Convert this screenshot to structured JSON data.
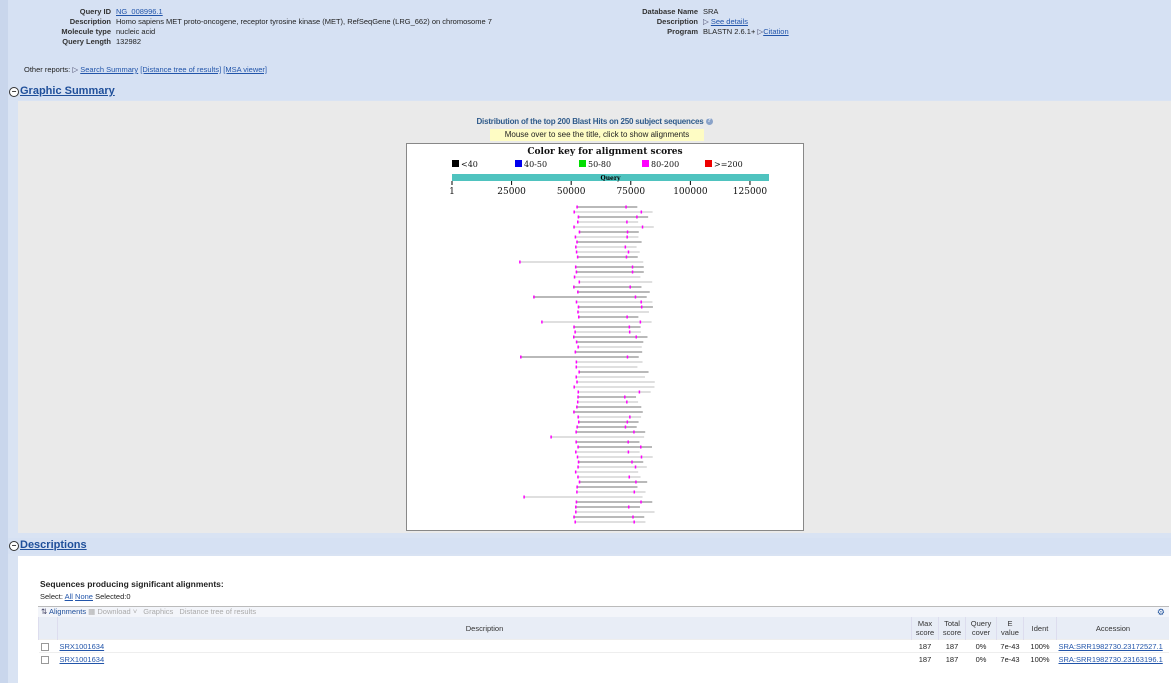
{
  "query_info": {
    "query_id_label": "Query ID",
    "query_id": "NG_008996.1",
    "description_label": "Description",
    "description": "Homo sapiens MET proto-oncogene, receptor tyrosine kinase (MET), RefSeqGene (LRG_662) on chromosome 7",
    "molecule_type_label": "Molecule type",
    "molecule_type": "nucleic acid",
    "query_length_label": "Query Length",
    "query_length": "132982",
    "database_name_label": "Database Name",
    "database_name": "SRA",
    "db_description_label": "Description",
    "db_description": "See details",
    "program_label": "Program",
    "program": "BLASTN 2.6.1+",
    "citation": "Citation"
  },
  "other_reports": {
    "label": "Other reports:",
    "search_summary": "Search Summary",
    "distance_tree": "[Distance tree of results]",
    "msa_viewer": "[MSA viewer]"
  },
  "graphic_summary": {
    "section_title": "Graphic Summary",
    "distribution_title": "Distribution of the top 200 Blast Hits on 250 subject sequences",
    "hint": "Mouse over to see the title, click to show alignments",
    "color_key_title": "Color key for alignment scores",
    "keys": [
      {
        "label": "<40",
        "color": "#000000"
      },
      {
        "label": "40-50",
        "color": "#0000ee"
      },
      {
        "label": "50-80",
        "color": "#00dd00"
      },
      {
        "label": "80-200",
        "color": "#ff00ff"
      },
      {
        "label": ">=200",
        "color": "#ee0000"
      }
    ],
    "query_bar_label": "Query",
    "ticks": [
      {
        "label": "1",
        "value": 1
      },
      {
        "label": "25000",
        "value": 25000
      },
      {
        "label": "50000",
        "value": 50000
      },
      {
        "label": "75000",
        "value": 75000
      },
      {
        "label": "100000",
        "value": 100000
      },
      {
        "label": "125000",
        "value": 125000
      }
    ]
  },
  "descriptions": {
    "section_title": "Descriptions",
    "heading": "Sequences producing significant alignments:",
    "select_label": "Select:",
    "select_all": "All",
    "select_none": "None",
    "selected": "Selected:0",
    "toolbar": {
      "alignments": "Alignments",
      "download": "Download",
      "graphics": "Graphics",
      "distance_tree": "Distance tree of results"
    },
    "columns": {
      "description": "Description",
      "max_score": "Max score",
      "total_score": "Total score",
      "query_cover": "Query cover",
      "e_value": "E value",
      "ident": "Ident",
      "accession": "Accession"
    },
    "rows": [
      {
        "description": "SRX1001634",
        "max_score": "187",
        "total_score": "187",
        "query_cover": "0%",
        "e_value": "7e-43",
        "ident": "100%",
        "accession": "SRA:SRR1982730.23172527.1"
      },
      {
        "description": "SRX1001634",
        "max_score": "187",
        "total_score": "187",
        "query_cover": "0%",
        "e_value": "7e-43",
        "ident": "100%",
        "accession": "SRA:SRR1982730.23163196.1"
      }
    ]
  }
}
